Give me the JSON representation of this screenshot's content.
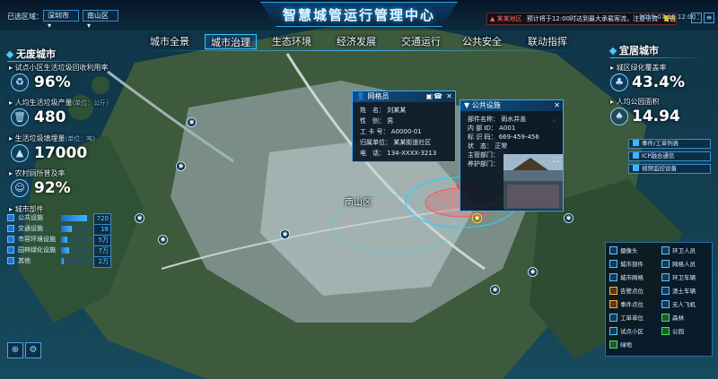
{
  "header": {
    "title": "智慧城管运行管理中心",
    "region_label": "已选区域：",
    "city": "深圳市",
    "district": "南山区",
    "alert_tag": "某某地区",
    "alert_text": "预计将于12:00时达到最大承载客流，注意引流",
    "alert_warn": "警告",
    "datetime": "2019-07-10 12:00"
  },
  "nav": [
    "城市全景",
    "城市治理",
    "生态环境",
    "经济发展",
    "交通运行",
    "公共安全",
    "联动指挥"
  ],
  "left": {
    "section_title": "无废城市",
    "metrics": [
      {
        "label": "试点小区生活垃圾回收利用率",
        "unit": "",
        "value": "96%",
        "icon": "recycle-icon"
      },
      {
        "label": "人均生活垃圾产量",
        "unit": "(单位：公斤)",
        "value": "480",
        "icon": "bin-icon"
      },
      {
        "label": "生活垃圾填埋量",
        "unit": "(单位：吨)",
        "value": "17000",
        "icon": "landfill-icon"
      },
      {
        "label": "农村厕所普及率",
        "unit": "",
        "value": "92%",
        "icon": "toilet-icon"
      }
    ],
    "components_title": "城市部件",
    "components": [
      {
        "name": "公共设施",
        "value": "720万",
        "level": 0.85
      },
      {
        "name": "交通设施",
        "value": "18万",
        "level": 0.35
      },
      {
        "name": "市容环境设施",
        "value": "5万",
        "level": 0.2
      },
      {
        "name": "园林绿化设施",
        "value": "7万",
        "level": 0.25
      },
      {
        "name": "其他",
        "value": "2万",
        "level": 0.1
      }
    ]
  },
  "right": {
    "section_title": "宜居城市",
    "metrics": [
      {
        "label": "城区绿化覆盖率",
        "value": "43.4%"
      },
      {
        "label": "人均公园面积",
        "value": "14.94"
      }
    ],
    "buttons": [
      "事件/工单列表",
      "ICP融合通信",
      "视频监控设备"
    ]
  },
  "legend": {
    "col1": [
      "摄像头",
      "城市部件",
      "城市网格",
      "告警点位",
      "事件点位",
      "工单单位",
      "试点小区",
      "绿地"
    ],
    "col2": [
      "环卫人员",
      "网格人员",
      "环卫车辆",
      "渣土车辆",
      "无人飞机",
      "森林",
      "公园"
    ]
  },
  "grid_popup": {
    "title": "网格员",
    "rows": [
      {
        "k": "姓　名：",
        "v": "刘某某"
      },
      {
        "k": "性　别：",
        "v": "男"
      },
      {
        "k": "工 卡 号：",
        "v": "A0000-01"
      },
      {
        "k": "归属单位：",
        "v": "某某街道社区"
      },
      {
        "k": "电　话：",
        "v": "134-XXXX-3213"
      }
    ]
  },
  "facility_popup": {
    "title": "公共设施",
    "rows": [
      {
        "k": "部件名称：",
        "v": "雨水井盖"
      },
      {
        "k": "内 部 ID：",
        "v": "A001"
      },
      {
        "k": "标 识 码：",
        "v": "669-459-456"
      },
      {
        "k": "状　态：",
        "v": "正常"
      },
      {
        "k": "主管部门：",
        "v": ""
      },
      {
        "k": "养护部门：",
        "v": ""
      }
    ]
  },
  "map": {
    "area_label": "南山区"
  },
  "colors": {
    "accent": "#3bb7ff",
    "alert": "#ff6060",
    "sea": "#0f3a4f",
    "land": "#3d5a3a"
  }
}
